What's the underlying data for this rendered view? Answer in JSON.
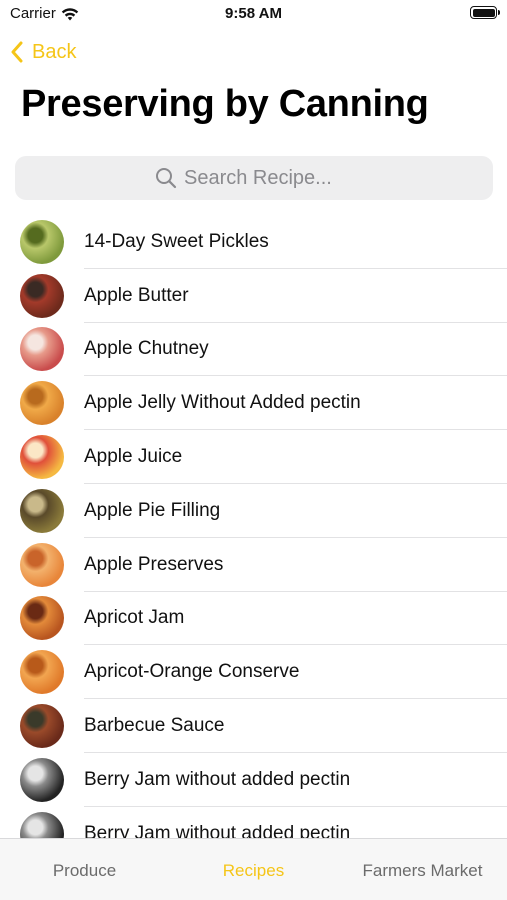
{
  "status_bar": {
    "carrier": "Carrier",
    "time": "9:58 AM"
  },
  "nav": {
    "back_label": "Back"
  },
  "page": {
    "title": "Preserving by Canning"
  },
  "search": {
    "placeholder": "Search Recipe..."
  },
  "recipes": [
    {
      "name": "14-Day Sweet Pickles",
      "thumb": "pickles",
      "colors": [
        "#7f9a3c",
        "#b8c76a",
        "#556b1f"
      ]
    },
    {
      "name": "Apple Butter",
      "thumb": "apple-butter",
      "colors": [
        "#6e2a1c",
        "#a33a2a",
        "#3a2a24"
      ]
    },
    {
      "name": "Apple Chutney",
      "thumb": "apple-chutney",
      "colors": [
        "#c94c4c",
        "#e79a8a",
        "#f5e6e0"
      ]
    },
    {
      "name": "Apple Jelly Without Added pectin",
      "thumb": "jelly-jar",
      "colors": [
        "#d9822b",
        "#f0a948",
        "#b86a1e"
      ]
    },
    {
      "name": "Apple Juice",
      "thumb": "apple-juice",
      "colors": [
        "#f5b942",
        "#e0503a",
        "#fbe7c6"
      ]
    },
    {
      "name": "Apple Pie Filling",
      "thumb": "pie-filling",
      "colors": [
        "#8a7a3a",
        "#5a4a2a",
        "#c9b98a"
      ]
    },
    {
      "name": "Apple Preserves",
      "thumb": "preserves",
      "colors": [
        "#e8863a",
        "#f3b16c",
        "#c9642a"
      ]
    },
    {
      "name": "Apricot Jam",
      "thumb": "apricot-jam",
      "colors": [
        "#b8551f",
        "#e38a3a",
        "#6a2a14"
      ]
    },
    {
      "name": "Apricot-Orange Conserve",
      "thumb": "conserve-jar",
      "colors": [
        "#e07a2a",
        "#f2a550",
        "#b85a1a"
      ]
    },
    {
      "name": "Barbecue Sauce",
      "thumb": "bbq-sauce",
      "colors": [
        "#6a2a1a",
        "#9a4a2a",
        "#3a3a2a"
      ]
    },
    {
      "name": "Berry Jam without added pectin",
      "thumb": "berry-jam",
      "colors": [
        "#222222",
        "#8a8a8a",
        "#e5e5e5"
      ]
    },
    {
      "name": "Berry Jam without added pectin",
      "thumb": "berry-jam-2",
      "colors": [
        "#222222",
        "#8a8a8a",
        "#e5e5e5"
      ]
    }
  ],
  "tabs": [
    {
      "label": "Produce",
      "active": false
    },
    {
      "label": "Recipes",
      "active": true
    },
    {
      "label": "Farmers Market",
      "active": false
    }
  ],
  "colors": {
    "accent": "#f5c518",
    "separator": "#e2e2e4",
    "search_bg": "#eeeeef"
  }
}
